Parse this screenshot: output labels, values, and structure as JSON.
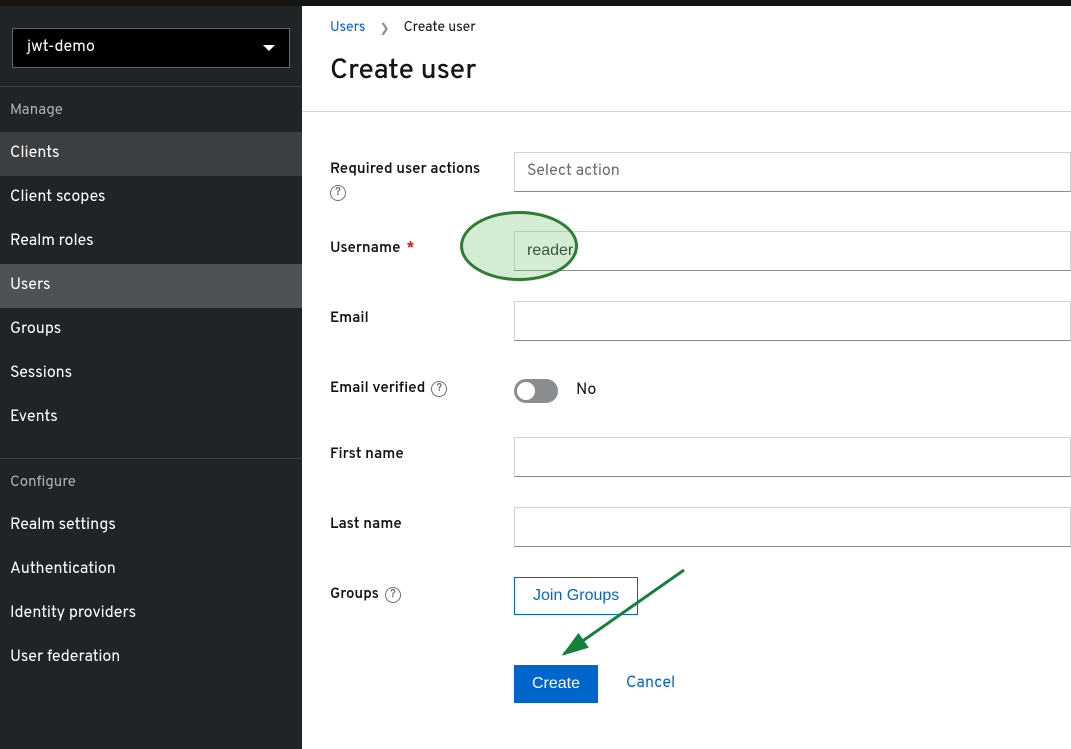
{
  "realm": {
    "selected": "jwt-demo"
  },
  "sidebar": {
    "section_manage": "Manage",
    "section_configure": "Configure",
    "manage_items": [
      {
        "label": "Clients"
      },
      {
        "label": "Client scopes"
      },
      {
        "label": "Realm roles"
      },
      {
        "label": "Users"
      },
      {
        "label": "Groups"
      },
      {
        "label": "Sessions"
      },
      {
        "label": "Events"
      }
    ],
    "configure_items": [
      {
        "label": "Realm settings"
      },
      {
        "label": "Authentication"
      },
      {
        "label": "Identity providers"
      },
      {
        "label": "User federation"
      }
    ]
  },
  "breadcrumb": {
    "parent": "Users",
    "current": "Create user"
  },
  "page_title": "Create user",
  "form": {
    "required_actions_label": "Required user actions",
    "required_actions_placeholder": "Select action",
    "username_label": "Username",
    "username_value": "reader",
    "email_label": "Email",
    "email_value": "",
    "email_verified_label": "Email verified",
    "email_verified_state": "No",
    "first_name_label": "First name",
    "first_name_value": "",
    "last_name_label": "Last name",
    "last_name_value": "",
    "groups_label": "Groups",
    "join_groups_button": "Join Groups",
    "create_button": "Create",
    "cancel_button": "Cancel"
  }
}
